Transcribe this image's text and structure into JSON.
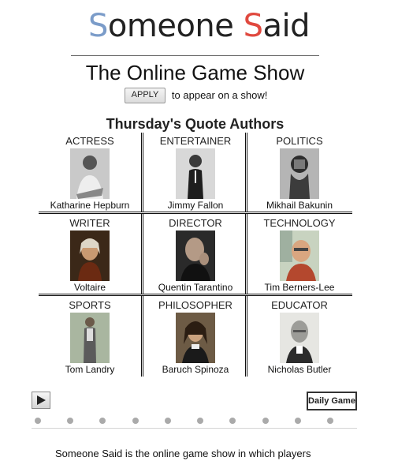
{
  "logo": {
    "s1": "S",
    "rest1": "omeone ",
    "s2": "S",
    "rest2": "aid"
  },
  "subtitle": "The Online Game Show",
  "apply": {
    "button_label": "APPLY",
    "text": "to appear on a show!"
  },
  "grid_title": "Thursday's Quote Authors",
  "authors": [
    {
      "role": "ACTRESS",
      "name": "Katharine Hepburn"
    },
    {
      "role": "ENTERTAINER",
      "name": "Jimmy Fallon"
    },
    {
      "role": "POLITICS",
      "name": "Mikhail Bakunin"
    },
    {
      "role": "WRITER",
      "name": "Voltaire"
    },
    {
      "role": "DIRECTOR",
      "name": "Quentin Tarantino"
    },
    {
      "role": "TECHNOLOGY",
      "name": "Tim Berners-Lee"
    },
    {
      "role": "SPORTS",
      "name": "Tom Landry"
    },
    {
      "role": "PHILOSOPHER",
      "name": "Baruch Spinoza"
    },
    {
      "role": "EDUCATOR",
      "name": "Nicholas Butler"
    }
  ],
  "controls": {
    "play_icon": "play-icon",
    "daily_label": "Daily Game"
  },
  "dots_count": 10,
  "footer": "Someone Said is the online game show in which players",
  "colors": {
    "logo_s1": "#7b9cc9",
    "logo_s2": "#e0493f"
  }
}
